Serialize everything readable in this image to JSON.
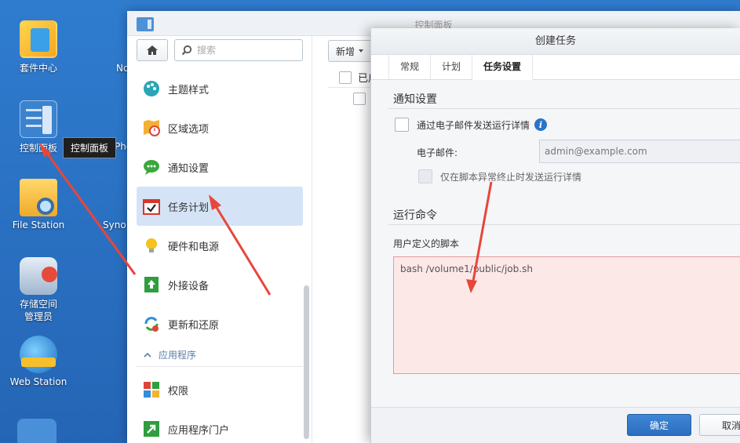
{
  "desktop": {
    "icons": [
      {
        "label": "套件中心"
      },
      {
        "label": "控制面板"
      },
      {
        "label": "File Station"
      },
      {
        "label": "存储空间\n管理员"
      },
      {
        "label": "Web Station"
      }
    ],
    "cut_labels": [
      "No",
      "Pho",
      "Syno"
    ],
    "tooltip": "控制面板"
  },
  "control_panel": {
    "title": "控制面板",
    "search_placeholder": "搜索",
    "nav": [
      {
        "label": "主题样式",
        "icon": "palette-icon"
      },
      {
        "label": "区域选项",
        "icon": "region-clock-icon"
      },
      {
        "label": "通知设置",
        "icon": "chat-bubble-icon"
      },
      {
        "label": "任务计划",
        "icon": "calendar-check-icon",
        "active": true
      },
      {
        "label": "硬件和电源",
        "icon": "lightbulb-icon"
      },
      {
        "label": "外接设备",
        "icon": "upload-device-icon"
      },
      {
        "label": "更新和还原",
        "icon": "refresh-icon"
      }
    ],
    "section_apps": "应用程序",
    "nav_apps": [
      {
        "label": "权限",
        "icon": "permissions-icon"
      },
      {
        "label": "应用程序门户",
        "icon": "portal-arrow-icon"
      }
    ],
    "toolbar": {
      "add_label": "新增"
    },
    "list": {
      "header_col": "已启"
    }
  },
  "dialog": {
    "title": "创建任务",
    "tabs": [
      {
        "label": "常规"
      },
      {
        "label": "计划"
      },
      {
        "label": "任务设置",
        "active": true
      }
    ],
    "notify": {
      "section_title": "通知设置",
      "email_checkbox_label": "通过电子邮件发送运行详情",
      "email_label": "电子邮件:",
      "email_value": "admin@example.com",
      "abnormal_only_label": "仅在脚本异常终止时发送运行详情"
    },
    "run": {
      "section_title": "运行命令",
      "script_label": "用户定义的脚本",
      "script_value": "bash /volume1/public/job.sh"
    },
    "ok_label": "确定",
    "cancel_label": "取消"
  },
  "colors": {
    "accent": "#2c6fbf",
    "active_nav": "#d4e4f6",
    "highlight_script": "#fde8e8",
    "arrow": "#e8463a"
  }
}
